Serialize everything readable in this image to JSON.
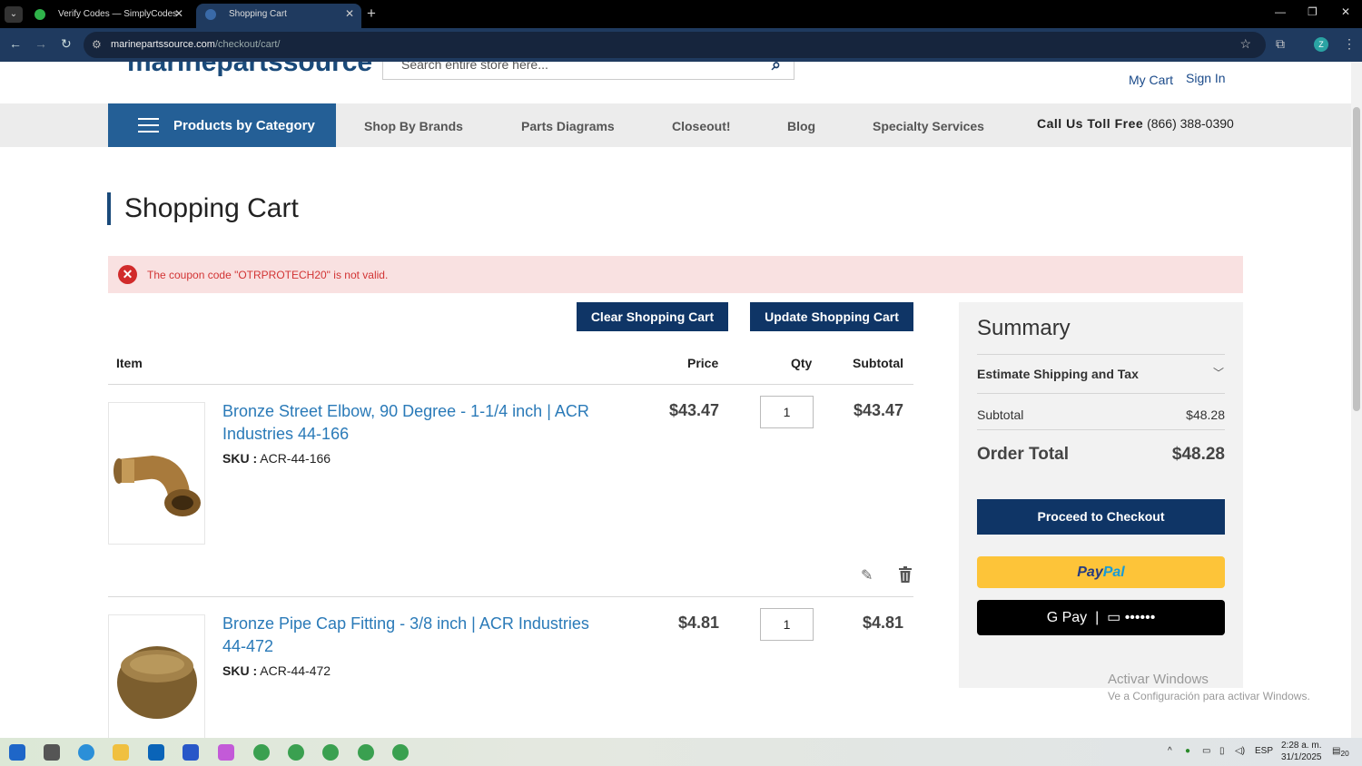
{
  "browser": {
    "tabs": [
      {
        "label": "Verify Codes — SimplyCodes",
        "close": "✕"
      },
      {
        "label": "Shopping Cart",
        "close": "✕"
      }
    ],
    "new_tab": "+",
    "url_host": "marinepartssource.com",
    "url_path": "/checkout/cart/",
    "profile_initial": "Z"
  },
  "header": {
    "logo_text": "marinepartssource",
    "search_placeholder": "Search entire store here...",
    "my_cart": "My Cart",
    "sign_in": "Sign In"
  },
  "nav": {
    "category_button": "Products by Category",
    "links": [
      "Shop By Brands",
      "Parts Diagrams",
      "Closeout!",
      "Blog",
      "Specialty Services"
    ],
    "toll_free_label": "Call Us Toll Free",
    "toll_free_number": "(866) 388-0390"
  },
  "cart": {
    "title": "Shopping Cart",
    "alert": "The coupon code \"OTRPROTECH20\" is not valid.",
    "clear_button": "Clear Shopping Cart",
    "update_button": "Update Shopping Cart",
    "columns": {
      "item": "Item",
      "price": "Price",
      "qty": "Qty",
      "subtotal": "Subtotal"
    },
    "sku_label": "SKU :",
    "items": [
      {
        "name": "Bronze Street Elbow, 90 Degree - 1-1/4 inch | ACR Industries 44-166",
        "sku": "ACR-44-166",
        "price": "$43.47",
        "qty": "1",
        "subtotal": "$43.47"
      },
      {
        "name": "Bronze Pipe Cap Fitting - 3/8 inch | ACR Industries 44-472",
        "sku": "ACR-44-472",
        "price": "$4.81",
        "qty": "1",
        "subtotal": "$4.81"
      }
    ]
  },
  "summary": {
    "title": "Summary",
    "estimate": "Estimate Shipping and Tax",
    "subtotal_label": "Subtotal",
    "subtotal_value": "$48.28",
    "total_label": "Order Total",
    "total_value": "$48.28",
    "checkout_button": "Proceed to Checkout",
    "paypal_pay": "Pay",
    "paypal_pal": "Pal",
    "gpay_label": "G Pay",
    "gpay_card_mask": "••••••"
  },
  "watermark": {
    "line1": "Activar Windows",
    "line2": "Ve a Configuración para activar Windows."
  },
  "taskbar": {
    "lang": "ESP",
    "time": "2:28 a. m.",
    "date": "31/1/2025",
    "notif_count": "20"
  },
  "colors": {
    "brand": "#0f3566",
    "link": "#2a7ab8",
    "alert_bg": "#f9e1e1",
    "alert_text": "#d23434"
  }
}
